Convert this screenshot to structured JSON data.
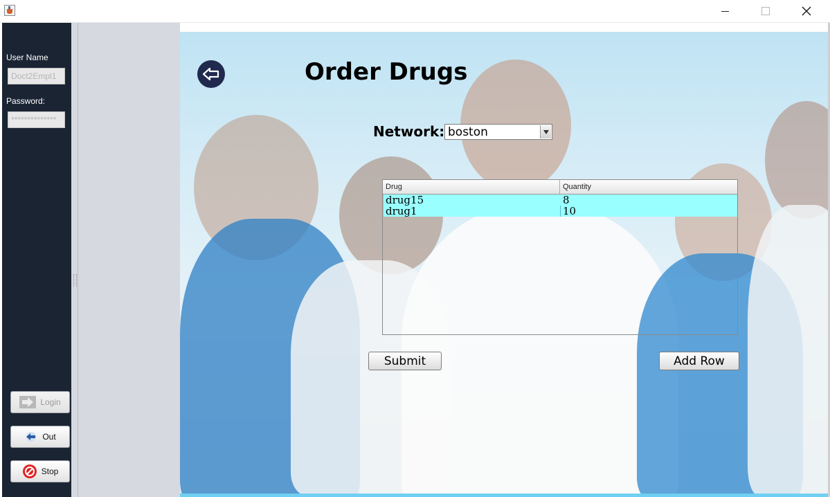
{
  "window": {
    "title": ""
  },
  "sidebar": {
    "username_label": "User Name",
    "username_value": "Doct2Empl1",
    "password_label": "Password:",
    "password_value": "**************",
    "login_label": "Login",
    "logout_label": "Out",
    "stop_label": "Stop"
  },
  "main": {
    "title": "Order Drugs",
    "network_label": "Network:",
    "network_value": "boston",
    "table": {
      "headers": [
        "Drug",
        "Quantity"
      ],
      "rows": [
        [
          "drug15",
          "8"
        ],
        [
          "drug1",
          "10"
        ]
      ]
    },
    "submit_label": "Submit",
    "add_row_label": "Add Row"
  },
  "colors": {
    "sidebar_bg": "#1b2433",
    "selected_row": "#99ffff",
    "back_button": "#1f2a4e",
    "accent_strip": "#6fd0f2"
  },
  "icons": [
    "java-app-icon",
    "minimize-icon",
    "maximize-icon",
    "close-icon",
    "login-arrow-icon",
    "logout-arrow-icon",
    "stop-icon",
    "back-arrow-icon",
    "dropdown-arrow-icon"
  ]
}
